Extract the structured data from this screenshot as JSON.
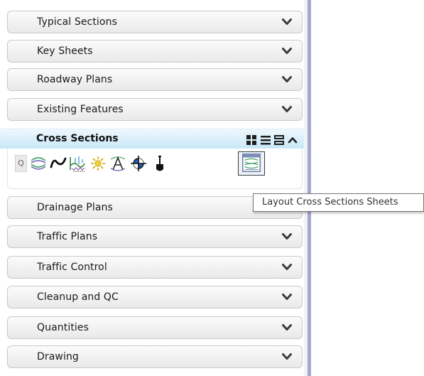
{
  "sections": [
    {
      "label": "Typical Sections"
    },
    {
      "label": "Key Sheets"
    },
    {
      "label": "Roadway Plans"
    },
    {
      "label": "Existing Features"
    }
  ],
  "expanded": {
    "label": "Cross Sections",
    "view_buttons": [
      "large-icons-icon",
      "list-view-icon",
      "details-view-icon",
      "collapse-chevron-icon"
    ],
    "toolbar": {
      "q_label": "Q",
      "tools": [
        "cross-section-template-icon",
        "wave-curve-icon",
        "terrain-section-icon",
        "sun-burst-icon",
        "text-annotation-icon",
        "crosshair-target-icon",
        "shovel-icon",
        "layout-cross-sections-sheets-icon"
      ],
      "selected_tool": "layout-cross-sections-sheets-icon"
    }
  },
  "tooltip": {
    "text": "Layout Cross Sections Sheets"
  },
  "sections_after": [
    {
      "label": "Drainage Plans"
    },
    {
      "label": "Traffic Plans"
    },
    {
      "label": "Traffic Control"
    },
    {
      "label": "Cleanup and QC"
    },
    {
      "label": "Quantities"
    },
    {
      "label": "Drawing"
    }
  ],
  "colors": {
    "expanded_header": "#c8e8f8",
    "side_rail": "#a5a7d3"
  }
}
